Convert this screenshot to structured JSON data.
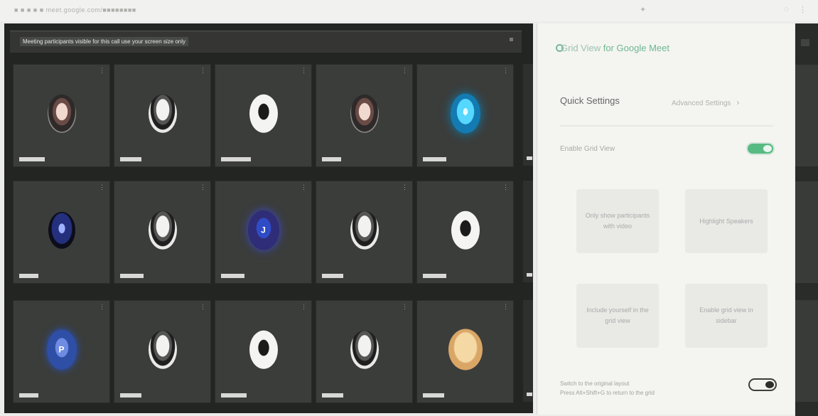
{
  "browser": {
    "url": "■ ■ ■ ■ ■ meet.google.com/■■■■■■■■",
    "icons": [
      "extension-icon",
      "profile-icon",
      "more-icon"
    ]
  },
  "meeting": {
    "banner": "Meeting participants visible for this call use your screen size only"
  },
  "tiles": [
    {
      "name": "Jordan",
      "kind": "photo dark",
      "initial": ""
    },
    {
      "name": "Maya",
      "kind": "photo",
      "initial": ""
    },
    {
      "name": "Rosalind",
      "kind": "photo light",
      "initial": ""
    },
    {
      "name": "Ivy",
      "kind": "photo dark",
      "initial": ""
    },
    {
      "name": "Navid",
      "kind": "photo cyan",
      "initial": "+"
    },
    {
      "name": "Dan",
      "kind": "photo navy",
      "initial": ""
    },
    {
      "name": "Corin",
      "kind": "photo",
      "initial": ""
    },
    {
      "name": "Emily",
      "kind": "photo purple",
      "initial": "J"
    },
    {
      "name": "Brit",
      "kind": "photo",
      "initial": ""
    },
    {
      "name": "Holly",
      "kind": "photo light",
      "initial": ""
    },
    {
      "name": "Pat",
      "kind": "photo blue",
      "initial": "P"
    },
    {
      "name": "Nina",
      "kind": "photo",
      "initial": ""
    },
    {
      "name": "Marcus",
      "kind": "photo light",
      "initial": ""
    },
    {
      "name": "Sara",
      "kind": "photo",
      "initial": ""
    },
    {
      "name": "Chen",
      "kind": "photo gold",
      "initial": ""
    }
  ],
  "panel": {
    "title": "Grid View",
    "title_accent": "for Google Meet",
    "quick_settings": "Quick Settings",
    "advanced_settings": "Advanced Settings",
    "enable_toggle_label": "Enable Grid View",
    "cards": [
      "Only show participants with video",
      "Highlight Speakers",
      "Include yourself in the grid view",
      "Enable grid view in sidebar"
    ],
    "footer": "Switch to the original layout",
    "footer_sub": "Press Alt+Shift+G to return to the grid"
  }
}
